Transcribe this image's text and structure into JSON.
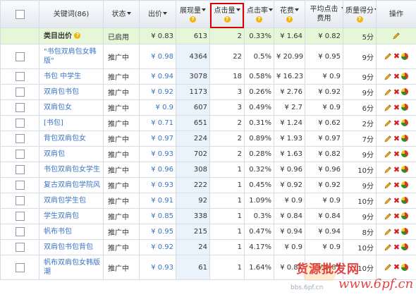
{
  "header": {
    "keyword": "关键词(86)",
    "status": "状态",
    "bid": "出价",
    "impressions": "展现量",
    "clicks": "点击量",
    "ctr": "点击率",
    "cost": "花费",
    "avg_cpc": "平均点击费用",
    "quality": "质量得分",
    "action": "操作"
  },
  "category_row": {
    "keyword": "类目出价",
    "status": "已启用",
    "bid": "¥ 0.83",
    "impressions": "613",
    "clicks": "2",
    "ctr": "0.33%",
    "cost": "¥ 1.64",
    "avg_cpc": "¥ 0.82",
    "quality": "5分"
  },
  "rows": [
    {
      "keyword": "\"书包双肩包女韩版\"",
      "status": "推广中",
      "bid": "¥ 0.98",
      "impressions": "4364",
      "clicks": "22",
      "ctr": "0.5%",
      "cost": "¥ 20.99",
      "avg_cpc": "¥ 0.95",
      "quality": "9分"
    },
    {
      "keyword": "书包 中学生",
      "status": "推广中",
      "bid": "¥ 0.94",
      "impressions": "3078",
      "clicks": "18",
      "ctr": "0.58%",
      "cost": "¥ 16.23",
      "avg_cpc": "¥ 0.9",
      "quality": "9分"
    },
    {
      "keyword": "双肩包书包",
      "status": "推广中",
      "bid": "¥ 0.92",
      "impressions": "1173",
      "clicks": "3",
      "ctr": "0.26%",
      "cost": "¥ 2.76",
      "avg_cpc": "¥ 0.92",
      "quality": "9分"
    },
    {
      "keyword": "双肩包女",
      "status": "推广中",
      "bid": "¥ 0.9",
      "impressions": "607",
      "clicks": "3",
      "ctr": "0.49%",
      "cost": "¥ 2.7",
      "avg_cpc": "¥ 0.9",
      "quality": "6分"
    },
    {
      "keyword": "[书包]",
      "status": "推广中",
      "bid": "¥ 0.71",
      "impressions": "651",
      "clicks": "2",
      "ctr": "0.31%",
      "cost": "¥ 1.24",
      "avg_cpc": "¥ 0.62",
      "quality": "2分"
    },
    {
      "keyword": "背包双肩包女",
      "status": "推广中",
      "bid": "¥ 0.97",
      "impressions": "224",
      "clicks": "2",
      "ctr": "0.89%",
      "cost": "¥ 1.93",
      "avg_cpc": "¥ 0.97",
      "quality": "7分"
    },
    {
      "keyword": "双肩包",
      "status": "推广中",
      "bid": "¥ 0.93",
      "impressions": "702",
      "clicks": "2",
      "ctr": "0.28%",
      "cost": "¥ 1.63",
      "avg_cpc": "¥ 0.82",
      "quality": "9分"
    },
    {
      "keyword": "书包双肩包女学生",
      "status": "推广中",
      "bid": "¥ 0.96",
      "impressions": "308",
      "clicks": "1",
      "ctr": "0.32%",
      "cost": "¥ 0.96",
      "avg_cpc": "¥ 0.96",
      "quality": "10分"
    },
    {
      "keyword": "复古双肩包学院风",
      "status": "推广中",
      "bid": "¥ 0.93",
      "impressions": "222",
      "clicks": "1",
      "ctr": "0.45%",
      "cost": "¥ 0.92",
      "avg_cpc": "¥ 0.92",
      "quality": "9分"
    },
    {
      "keyword": "双肩包学生包",
      "status": "推广中",
      "bid": "¥ 0.91",
      "impressions": "92",
      "clicks": "1",
      "ctr": "1.09%",
      "cost": "¥ 0.9",
      "avg_cpc": "¥ 0.9",
      "quality": "10分"
    },
    {
      "keyword": "学生双肩包",
      "status": "推广中",
      "bid": "¥ 0.85",
      "impressions": "338",
      "clicks": "1",
      "ctr": "0.3%",
      "cost": "¥ 0.84",
      "avg_cpc": "¥ 0.84",
      "quality": "9分"
    },
    {
      "keyword": "帆布书包",
      "status": "推广中",
      "bid": "¥ 0.95",
      "impressions": "215",
      "clicks": "1",
      "ctr": "0.47%",
      "cost": "¥ 0.94",
      "avg_cpc": "¥ 0.94",
      "quality": "8分"
    },
    {
      "keyword": "双肩包书包背包",
      "status": "推广中",
      "bid": "¥ 0.92",
      "impressions": "24",
      "clicks": "1",
      "ctr": "4.17%",
      "cost": "¥ 0.9",
      "avg_cpc": "¥ 0.9",
      "quality": "10分"
    },
    {
      "keyword": "帆布双肩包女韩版潮",
      "status": "推广中",
      "bid": "¥ 0.93",
      "impressions": "61",
      "clicks": "1",
      "ctr": "1.64%",
      "cost": "¥ 0.87",
      "avg_cpc": "¥ 0.87",
      "quality": "10分"
    }
  ],
  "watermark": {
    "line1": "货源批发网",
    "line2": "www.6pf.cn",
    "line3": "bbs.6pf.cn"
  },
  "icons": [
    "question-icon",
    "pencil-icon",
    "delete-icon",
    "pie-chart-icon",
    "checkbox"
  ],
  "colors": {
    "link": "#3a75c4",
    "category_bg": "#e6f7d8",
    "highlight_border": "#d90000",
    "delete": "#d21f1f"
  }
}
